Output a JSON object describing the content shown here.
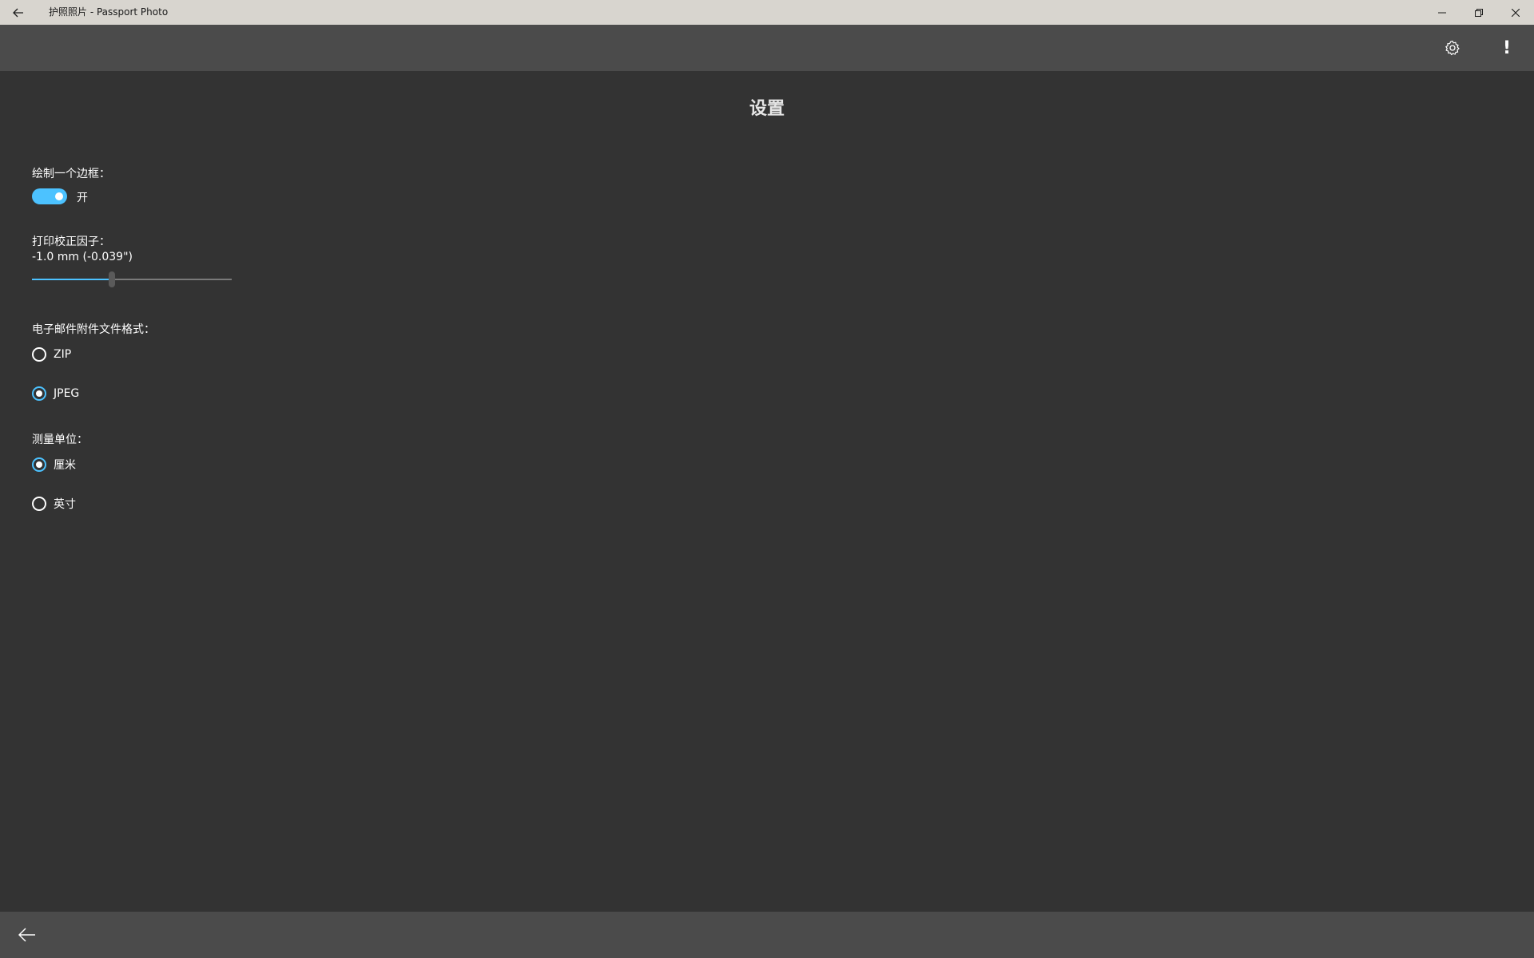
{
  "window": {
    "title": "护照照片 - Passport Photo",
    "back_icon": "back-arrow-icon",
    "minimize_icon": "minimize-icon",
    "restore_icon": "restore-icon",
    "close_icon": "close-icon"
  },
  "toolbar": {
    "settings_icon": "gear-icon",
    "about_label": "!"
  },
  "page": {
    "title": "设置"
  },
  "settings": {
    "border": {
      "label": "绘制一个边框：",
      "state_label": "开",
      "on": true
    },
    "print_correction": {
      "label": "打印校正因子：",
      "value_text": "-1.0 mm (-0.039\")",
      "slider_fraction": 0.4
    },
    "email_format": {
      "label": "电子邮件附件文件格式：",
      "options": [
        {
          "label": "ZIP",
          "checked": false
        },
        {
          "label": "JPEG",
          "checked": true
        }
      ]
    },
    "units": {
      "label": "测量单位：",
      "options": [
        {
          "label": "厘米",
          "checked": true
        },
        {
          "label": "英寸",
          "checked": false
        }
      ]
    }
  },
  "bottombar": {
    "back_icon": "back-arrow-icon"
  },
  "colors": {
    "accent": "#4cc2ff",
    "background": "#333333",
    "bar": "#4b4b4b",
    "titlebar": "#d8d5cf"
  }
}
